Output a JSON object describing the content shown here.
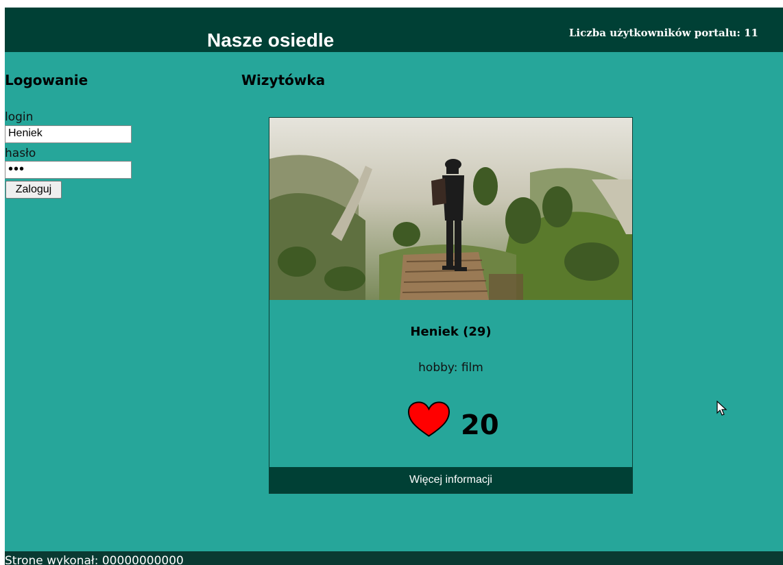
{
  "header": {
    "title": "Nasze osiedle",
    "user_count_label": "Liczba użytkowników portalu: 11"
  },
  "login": {
    "heading": "Logowanie",
    "login_label": "login",
    "login_value": "Heniek",
    "password_label": "hasło",
    "password_value": "•••",
    "button_label": "Zaloguj"
  },
  "card": {
    "heading": "Wizytówka",
    "name": "Heniek (29)",
    "hobby": "hobby: film",
    "likes": "20",
    "more_button": "Więcej informacji",
    "photo_icon": "traveler-photo",
    "heart_icon": "heart-icon"
  },
  "footer": {
    "text": "Strone wykonał: 00000000000"
  },
  "colors": {
    "background": "#26a69a",
    "header": "#004035",
    "heart": "#ff0000"
  }
}
